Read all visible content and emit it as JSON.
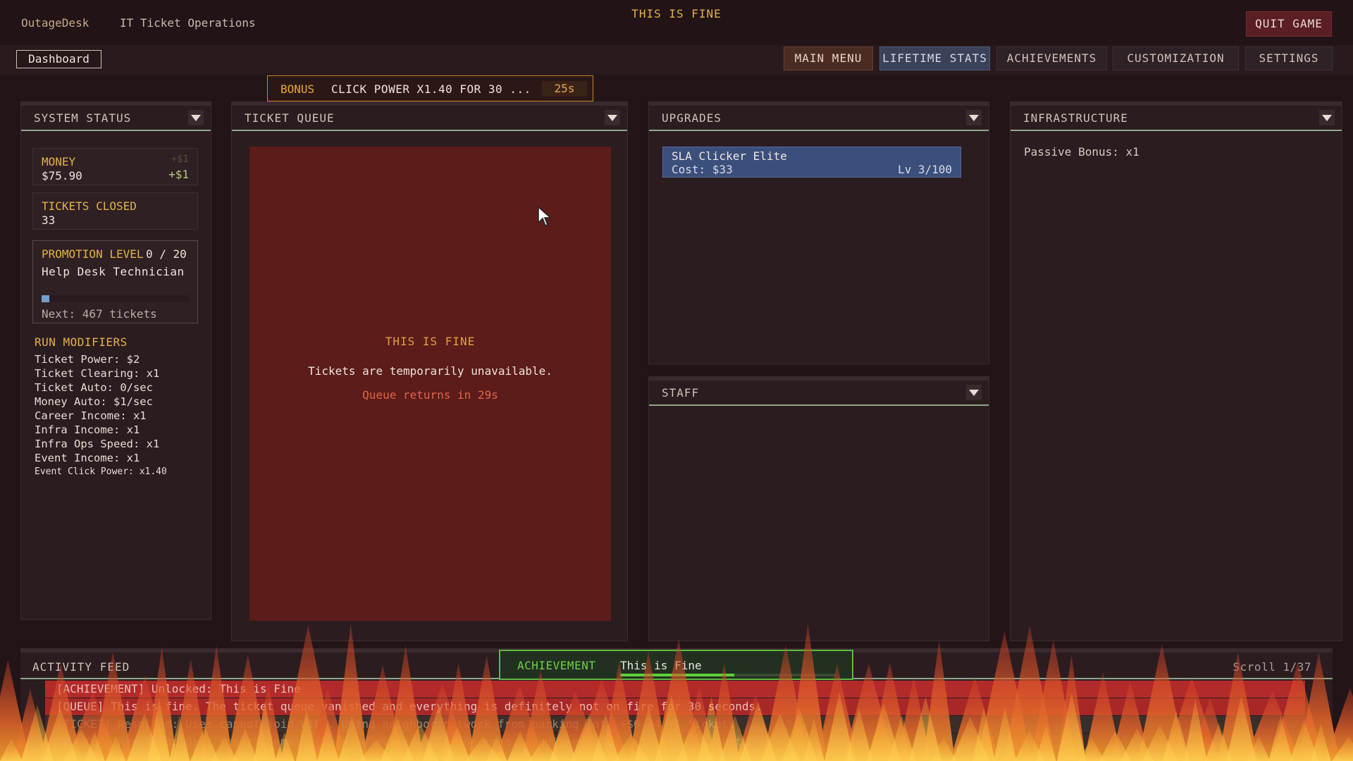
{
  "header": {
    "app_name": "OutageDesk",
    "app_subtitle": "IT Ticket Operations",
    "event_title": "THIS IS FINE",
    "quit_label": "QUIT GAME"
  },
  "nav": {
    "dashboard_label": "Dashboard",
    "main_menu": "MAIN MENU",
    "lifetime_stats": "LIFETIME STATS",
    "achievements": "ACHIEVEMENTS",
    "customization": "CUSTOMIZATION",
    "settings": "SETTINGS"
  },
  "bonus": {
    "label": "BONUS",
    "text": "CLICK POWER X1.40 FOR 30 ...",
    "timer": "25s"
  },
  "system_status": {
    "title": "SYSTEM STATUS",
    "money_label": "MONEY",
    "money_value": "$75.90",
    "money_ghost": "+$1",
    "money_delta": "+$1",
    "tickets_label": "TICKETS CLOSED",
    "tickets_value": "33",
    "promotion_label": "PROMOTION LEVEL",
    "promotion_count": "0 / 20",
    "promotion_title": "Help Desk Technician",
    "promotion_progress": 0.05,
    "promotion_next": "Next: 467 tickets",
    "modifiers_title": "RUN MODIFIERS",
    "modifiers": [
      "Ticket Power: $2",
      "Ticket Clearing: x1",
      "Ticket Auto: 0/sec",
      "Money Auto: $1/sec",
      "Career Income: x1",
      "Infra Income: x1",
      "Infra Ops Speed: x1",
      "Event Income: x1"
    ],
    "modifier_extra": "Event Click Power: x1.40"
  },
  "ticket_queue": {
    "title": "TICKET QUEUE",
    "event_title": "THIS IS FINE",
    "message": "Tickets are temporarily unavailable.",
    "returns": "Queue returns in 29s"
  },
  "upgrades": {
    "title": "UPGRADES",
    "item_name": "SLA Clicker Elite",
    "item_cost": "Cost: $33",
    "item_level": "Lv 3/100"
  },
  "staff": {
    "title": "STAFF"
  },
  "infrastructure": {
    "title": "INFRASTRUCTURE",
    "passive": "Passive Bonus: x1"
  },
  "feed": {
    "title": "ACTIVITY FEED",
    "scroll": "Scroll 1/37",
    "rows": [
      "[ACHIEVEMENT] Unlocked: This is Fine",
      "[QUEUE] This is fine. The ticket queue vanished and everything is definitely not on fire for 30 seconds.",
      "[TICKET] Resolved: User cannot join WiFi. Using neighbor network from parking lot.  +$6.44  +1 tickets",
      "[TICKET] Resolved: User reports email stuck in outbox. Offline mode proudly enabled.  +$6.44  +1 tickets"
    ]
  },
  "achievement_toast": {
    "label": "ACHIEVEMENT",
    "name": "This is Fine",
    "progress": 0.53
  },
  "colors": {
    "background": "#231417",
    "accent_gold": "#e3b24a",
    "queue_fire": "#5b1c1a",
    "upgrade_blue": "#3b4f7c",
    "achievement_green": "#5fb93f",
    "feed_alert": "#b32a2a"
  }
}
